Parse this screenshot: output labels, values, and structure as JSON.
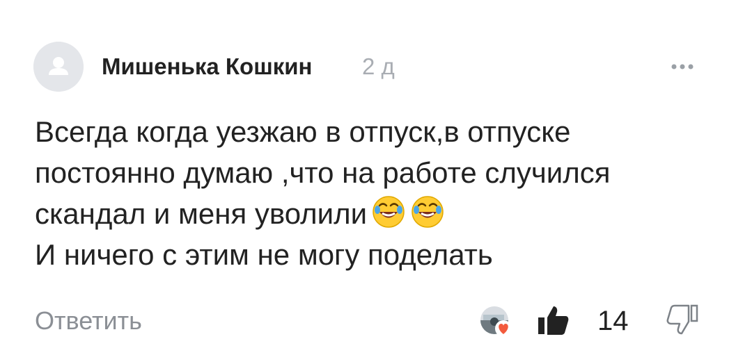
{
  "comment": {
    "author_name": "Мишенька Кошкин",
    "time_ago": "2 д",
    "text_lines": [
      "Всегда когда  уезжаю в отпуск,в отпуске",
      "постоянно думаю ,что на работе случился",
      "скандал и меня уволили",
      "И ничего с этим не могу поделать"
    ],
    "emojis": [
      "rolling-on-floor-laughing",
      "rolling-on-floor-laughing"
    ],
    "reply_label": "Ответить",
    "likes_count": "14"
  },
  "icons": {
    "avatar": "user-placeholder-icon",
    "more": "more-dots-icon",
    "like": "thumbs-up-filled-icon",
    "dislike": "thumbs-down-outline-icon",
    "reaction": "heart-badge-icon"
  },
  "colors": {
    "text": "#222222",
    "muted": "#8b8f95",
    "time": "#a9adb3",
    "avatar_bg": "#e4e6ea",
    "avatar_fg": "#ffffff",
    "heart": "#f35b3d"
  }
}
